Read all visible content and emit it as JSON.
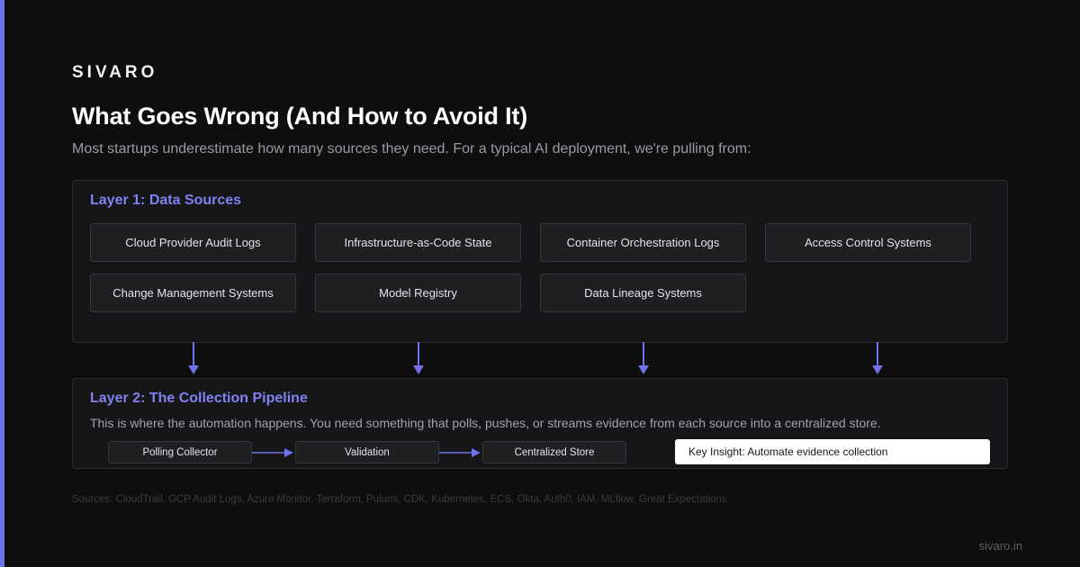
{
  "brand": "SIVARO",
  "title": "What Goes Wrong (And How to Avoid It)",
  "subtitle": "Most startups underestimate how many sources they need. For a typical AI deployment, we're pulling from:",
  "layer1": {
    "title": "Layer 1: Data Sources",
    "sources": [
      "Cloud Provider Audit Logs",
      "Infrastructure-as-Code State",
      "Container Orchestration Logs",
      "Access Control Systems",
      "Change Management Systems",
      "Model Registry",
      "Data Lineage Systems"
    ]
  },
  "layer2": {
    "title": "Layer 2: The Collection Pipeline",
    "description": "This is where the automation happens. You need something that polls, pushes, or streams evidence from each source into a centralized store.",
    "steps": [
      "Polling Collector",
      "Validation",
      "Centralized Store"
    ],
    "insight": "Key Insight: Automate evidence collection"
  },
  "sources_note": "Sources: CloudTrail, GCP Audit Logs, Azure Monitor, Terraform, Pulumi, CDK, Kubernetes, ECS, Okta, Auth0, IAM, MLflow, Great Expectations",
  "footer_url": "sivaro.in",
  "colors": {
    "accent": "#6f72e8",
    "heading_accent": "#7f82f0",
    "background": "#0e0e0f",
    "panel": "#161618"
  },
  "icons": {
    "connector": "arrow-down-icon",
    "flow": "arrow-right-icon"
  }
}
